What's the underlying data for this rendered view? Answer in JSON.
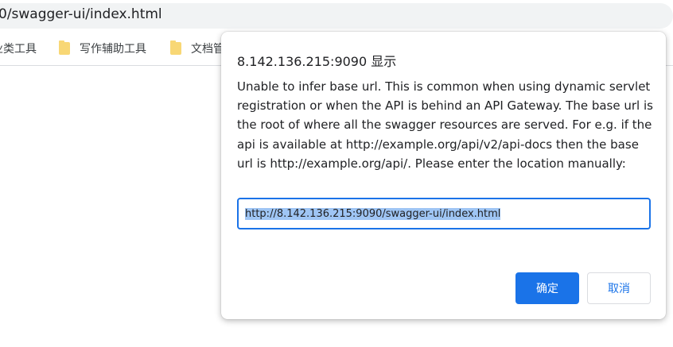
{
  "browser": {
    "url_partial": "0/swagger-ui/index.html",
    "bookmarks": [
      {
        "label": "工具类工具",
        "visible_text": "业类工具"
      },
      {
        "label": "写作辅助工具"
      },
      {
        "label": "文档管"
      }
    ]
  },
  "dialog": {
    "title": "8.142.136.215:9090 显示",
    "message": "Unable to infer base url. This is common when using dynamic servlet registration or when the API is behind an API Gateway. The base url is the root of where all the swagger resources are served. For e.g. if the api is available at http://example.org/api/v2/api-docs then the base url is http://example.org/api/. Please enter the location manually:",
    "input_value": "http://8.142.136.215:9090/swagger-ui/index.html",
    "ok_label": "确定",
    "cancel_label": "取消"
  },
  "colors": {
    "accent": "#1a73e8",
    "folder": "#f8d775",
    "selection": "#a5c7f5"
  }
}
